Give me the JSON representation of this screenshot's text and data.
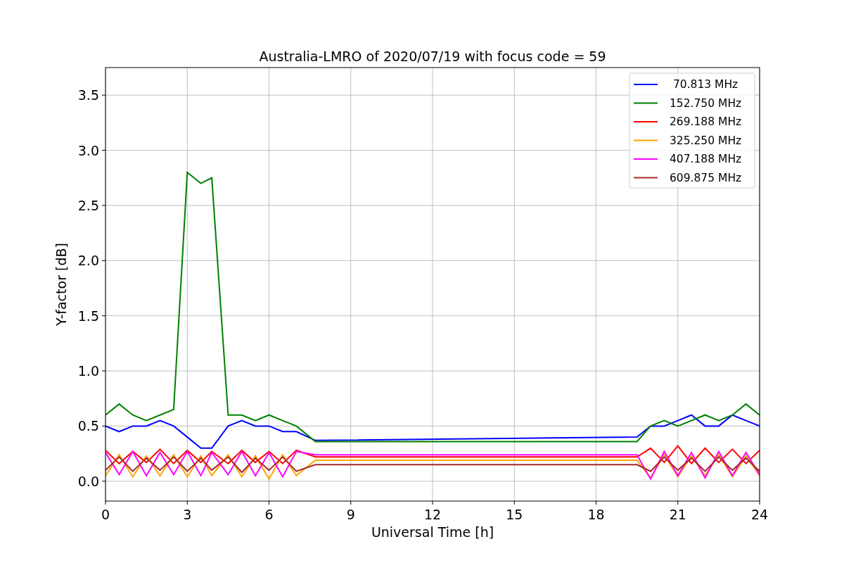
{
  "chart_data": {
    "type": "line",
    "title": "Australia-LMRO of 2020/07/19 with focus code = 59",
    "xlabel": "Universal Time [h]",
    "ylabel": "Y-factor [dB]",
    "x": [
      0,
      0.5,
      1,
      1.5,
      2,
      2.5,
      3,
      3.5,
      3.9,
      4.5,
      5,
      5.5,
      6,
      6.5,
      7,
      7.7,
      19.5,
      20,
      20.5,
      21,
      21.5,
      22,
      22.5,
      23,
      23.5,
      24
    ],
    "series": [
      {
        "name": " 70.813 MHz",
        "color": "#0000ff",
        "values": [
          0.5,
          0.45,
          0.5,
          0.5,
          0.55,
          0.5,
          0.4,
          0.3,
          0.3,
          0.5,
          0.55,
          0.5,
          0.5,
          0.45,
          0.45,
          0.37,
          0.4,
          0.5,
          0.5,
          0.55,
          0.6,
          0.5,
          0.5,
          0.6,
          0.55,
          0.5
        ]
      },
      {
        "name": "152.750 MHz",
        "color": "#008000",
        "values": [
          0.6,
          0.7,
          0.6,
          0.55,
          0.6,
          0.65,
          2.8,
          2.7,
          2.75,
          0.6,
          0.6,
          0.55,
          0.6,
          0.55,
          0.5,
          0.36,
          0.36,
          0.5,
          0.55,
          0.5,
          0.55,
          0.6,
          0.55,
          0.6,
          0.7,
          0.6
        ]
      },
      {
        "name": "269.188 MHz",
        "color": "#ff0000",
        "values": [
          0.28,
          0.16,
          0.27,
          0.17,
          0.29,
          0.16,
          0.28,
          0.17,
          0.27,
          0.16,
          0.28,
          0.17,
          0.27,
          0.16,
          0.28,
          0.22,
          0.22,
          0.3,
          0.17,
          0.32,
          0.16,
          0.3,
          0.17,
          0.29,
          0.16,
          0.28
        ]
      },
      {
        "name": "325.250 MHz",
        "color": "#ffa500",
        "values": [
          0.05,
          0.24,
          0.04,
          0.23,
          0.05,
          0.24,
          0.04,
          0.23,
          0.05,
          0.24,
          0.04,
          0.23,
          0.02,
          0.24,
          0.05,
          0.19,
          0.19,
          0.03,
          0.24,
          0.04,
          0.23,
          0.05,
          0.24,
          0.04,
          0.23,
          0.05
        ]
      },
      {
        "name": "407.188 MHz",
        "color": "#ff00ff",
        "values": [
          0.26,
          0.06,
          0.27,
          0.05,
          0.26,
          0.06,
          0.27,
          0.05,
          0.26,
          0.06,
          0.27,
          0.05,
          0.26,
          0.04,
          0.27,
          0.24,
          0.24,
          0.02,
          0.27,
          0.05,
          0.26,
          0.03,
          0.27,
          0.05,
          0.26,
          0.06
        ]
      },
      {
        "name": "609.875 MHz",
        "color": "#a52a2a",
        "values": [
          0.1,
          0.22,
          0.09,
          0.21,
          0.1,
          0.22,
          0.09,
          0.21,
          0.1,
          0.22,
          0.08,
          0.21,
          0.1,
          0.22,
          0.09,
          0.15,
          0.15,
          0.09,
          0.22,
          0.1,
          0.21,
          0.09,
          0.22,
          0.1,
          0.21,
          0.09
        ]
      }
    ],
    "xlim": [
      0,
      24
    ],
    "ylim": [
      -0.18,
      3.75
    ],
    "xticks": [
      0,
      3,
      6,
      9,
      12,
      15,
      18,
      21,
      24
    ],
    "yticks": [
      {
        "value": 0,
        "label": "0.0"
      },
      {
        "value": 0.5,
        "label": "0.5"
      },
      {
        "value": 1,
        "label": "1.0"
      },
      {
        "value": 1.5,
        "label": "1.5"
      },
      {
        "value": 2,
        "label": "2.0"
      },
      {
        "value": 2.5,
        "label": "2.5"
      },
      {
        "value": 3,
        "label": "3.0"
      },
      {
        "value": 3.5,
        "label": "3.5"
      }
    ],
    "grid": true,
    "legend": true
  }
}
